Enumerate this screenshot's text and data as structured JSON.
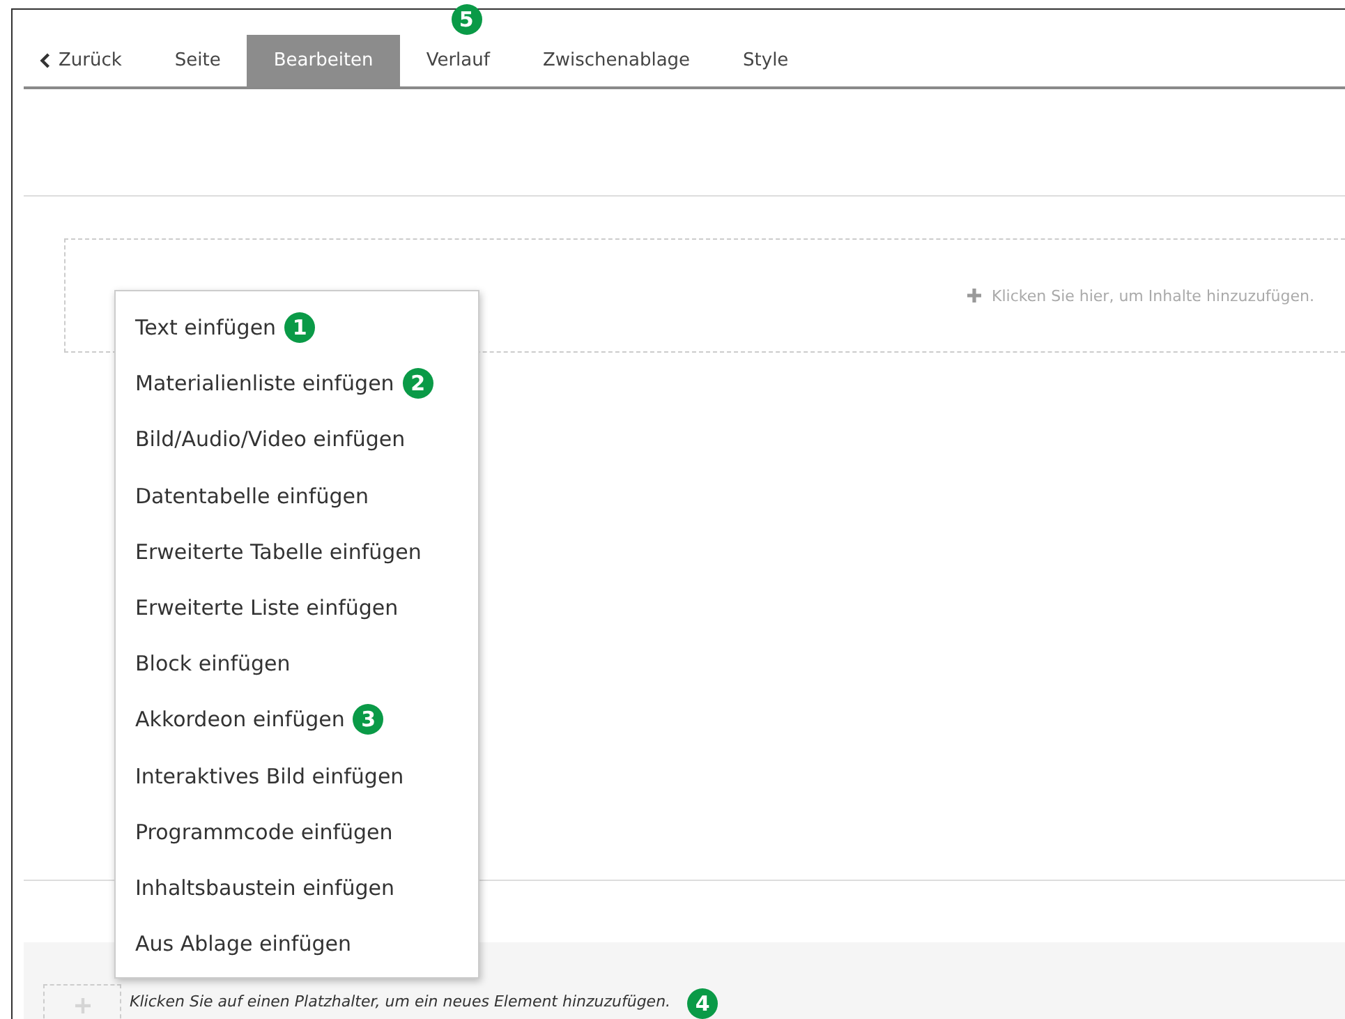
{
  "tabs": [
    {
      "label": "Zurück",
      "kind": "back",
      "selected": false
    },
    {
      "label": "Seite",
      "kind": "tab",
      "selected": false
    },
    {
      "label": "Bearbeiten",
      "kind": "tab",
      "selected": true
    },
    {
      "label": "Verlauf",
      "kind": "tab",
      "selected": false,
      "badge": "5"
    },
    {
      "label": "Zwischenablage",
      "kind": "tab",
      "selected": false
    },
    {
      "label": "Style",
      "kind": "tab",
      "selected": false
    }
  ],
  "dropzone": {
    "label": "Klicken Sie hier, um Inhalte hinzuzufügen."
  },
  "insert_menu": [
    {
      "label": "Text einfügen",
      "badge": "1"
    },
    {
      "label": "Materialienliste einfügen",
      "badge": "2"
    },
    {
      "label": "Bild/Audio/Video einfügen"
    },
    {
      "label": "Datentabelle einfügen"
    },
    {
      "label": "Erweiterte Tabelle einfügen"
    },
    {
      "label": "Erweiterte Liste einfügen"
    },
    {
      "label": "Block einfügen"
    },
    {
      "label": "Akkordeon einfügen",
      "badge": "3"
    },
    {
      "label": "Interaktives Bild einfügen"
    },
    {
      "label": "Programmcode einfügen"
    },
    {
      "label": "Inhaltsbaustein einfügen"
    },
    {
      "label": "Aus Ablage einfügen"
    }
  ],
  "footer_hint": {
    "label": "Klicken Sie auf einen Platzhalter, um ein neues Element hinzuzufügen.",
    "badge": "4"
  }
}
